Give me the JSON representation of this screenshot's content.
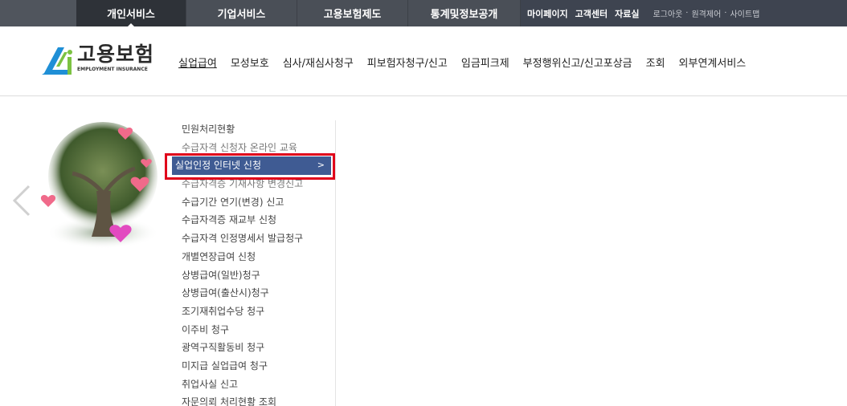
{
  "top_nav": {
    "tabs": [
      {
        "label": "개인서비스",
        "active": true
      },
      {
        "label": "기업서비스",
        "active": false
      },
      {
        "label": "고용보험제도",
        "active": false
      },
      {
        "label": "통계및정보공개",
        "active": false
      }
    ],
    "util_strong": [
      "마이페이지",
      "고객센터",
      "자료실"
    ],
    "util_small": [
      "로그아웃",
      "원격제어",
      "사이트맵"
    ],
    "util_separator": "·"
  },
  "logo": {
    "name_ko": "고용보험",
    "name_en": "EMPLOYMENT INSURANCE"
  },
  "main_nav": {
    "items": [
      {
        "label": "실업급여",
        "current": true
      },
      {
        "label": "모성보호",
        "current": false
      },
      {
        "label": "심사/재심사청구",
        "current": false
      },
      {
        "label": "피보험자청구/신고",
        "current": false
      },
      {
        "label": "임금피크제",
        "current": false
      },
      {
        "label": "부정행위신고/신고포상금",
        "current": false
      },
      {
        "label": "조회",
        "current": false
      },
      {
        "label": "외부연계서비스",
        "current": false
      }
    ]
  },
  "submenu": {
    "items": [
      {
        "label": "민원처리현황",
        "state": "normal"
      },
      {
        "label": "수급자격 신청자 온라인 교육",
        "state": "clipped"
      },
      {
        "label": "실업인정 인터넷 신청",
        "state": "active"
      },
      {
        "label": "수급자격증 기재사항 변경신고",
        "state": "clipped"
      },
      {
        "label": "수급기간 연기(변경) 신고",
        "state": "normal"
      },
      {
        "label": "수급자격증 재교부 신청",
        "state": "normal"
      },
      {
        "label": "수급자격 인정명세서 발급청구",
        "state": "normal"
      },
      {
        "label": "개별연장급여 신청",
        "state": "normal"
      },
      {
        "label": "상병급여(일반)청구",
        "state": "normal"
      },
      {
        "label": "상병급여(출산시)청구",
        "state": "normal"
      },
      {
        "label": "조기재취업수당 청구",
        "state": "normal"
      },
      {
        "label": "이주비 청구",
        "state": "normal"
      },
      {
        "label": "광역구직활동비 청구",
        "state": "normal"
      },
      {
        "label": "미지급 실업급여 청구",
        "state": "normal"
      },
      {
        "label": "취업사실 신고",
        "state": "normal"
      },
      {
        "label": "자문의뢰 처리현황 조회",
        "state": "normal"
      }
    ],
    "active_chevron": ">"
  },
  "colors": {
    "topbar": "#4a4f57",
    "active_menu": "#3f5b93",
    "highlight_box": "#e0001a"
  },
  "icons": [
    "carousel-prev-arrow-icon",
    "tree-illustration",
    "logo-mark-icon",
    "chevron-right-icon"
  ]
}
